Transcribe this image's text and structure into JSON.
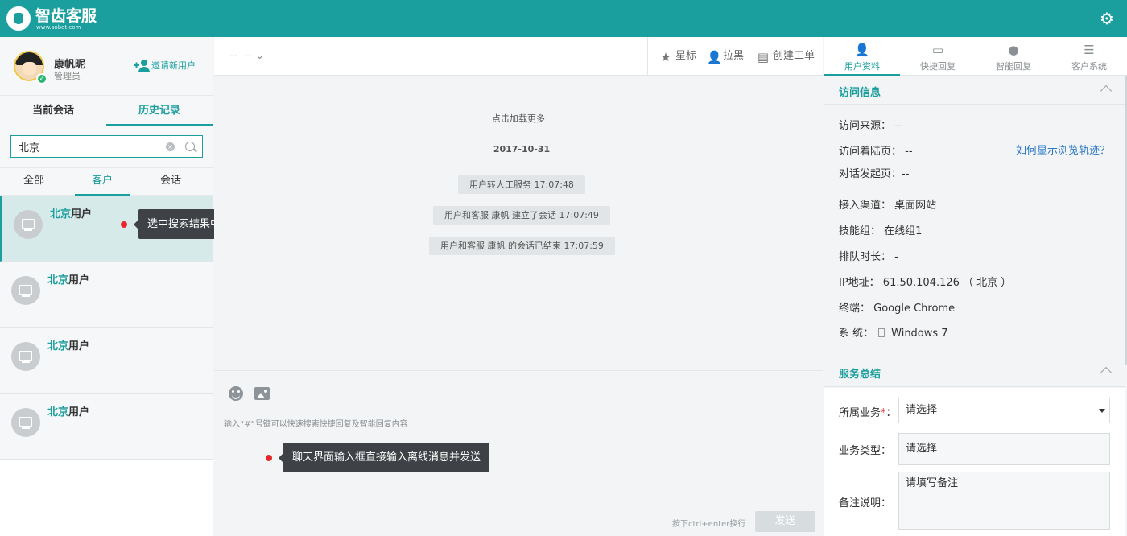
{
  "app": {
    "brand": "智齿客服",
    "brand_sub": "www.sobot.com"
  },
  "profile": {
    "name": "康帆昵",
    "role": "管理员",
    "invite_label": "邀请新用户"
  },
  "left_tabs": [
    "当前会话",
    "历史记录"
  ],
  "search": {
    "value": "北京"
  },
  "filter_tabs": [
    "全部",
    "客户",
    "会话"
  ],
  "results": [
    {
      "hl": "北京",
      "rest": "用户"
    },
    {
      "hl": "北京",
      "rest": "用户"
    },
    {
      "hl": "北京",
      "rest": "用户"
    },
    {
      "hl": "北京",
      "rest": "用户"
    }
  ],
  "tooltips": {
    "select_result": "选中搜索结果中想要回复的客户",
    "offline_msg": "聊天界面输入框直接输入离线消息并发送"
  },
  "chat": {
    "selector_prefix": "--",
    "selector_value": "--",
    "actions": {
      "star": "星标",
      "block": "拉黑",
      "ticket": "创建工单"
    },
    "load_more": "点击加载更多",
    "date": "2017-10-31",
    "system_messages": [
      "用户转人工服务 17:07:48",
      "用户和客服 康帆 建立了会话 17:07:49",
      "用户和客服 康帆 的会话已结束 17:07:59"
    ],
    "input_hint": "输入“#”号键可以快速搜索快捷回复及智能回复内容",
    "enter_hint": "按下ctrl+enter换行",
    "send_label": "发送"
  },
  "right_tabs": [
    "用户资料",
    "快捷回复",
    "智能回复",
    "客户系统"
  ],
  "visit_info": {
    "title": "访问信息",
    "source": "访问来源：  --",
    "landing": "访问着陆页：  --",
    "track_link": "如何显示浏览轨迹？",
    "start_page": "对话发起页：--",
    "channel": "接入渠道：  桌面网站",
    "skill_group": "技能组：  在线组1",
    "queue_time": "排队时长：  -",
    "ip": "IP地址：  61.50.104.126 （ 北京 ）",
    "terminal": "终端：  Google Chrome",
    "system_label": "系 统：",
    "system_value": "Windows 7"
  },
  "service_summary": {
    "title": "服务总结",
    "business_label": "所属业务",
    "business_value": "请选择",
    "type_label": "业务类型：",
    "type_value": "请选择",
    "note_label": "备注说明：",
    "note_placeholder": "请填写备注"
  },
  "colors": {
    "accent": "#1b9e9e",
    "link": "#2d79c7",
    "dot": "#e8262f"
  }
}
